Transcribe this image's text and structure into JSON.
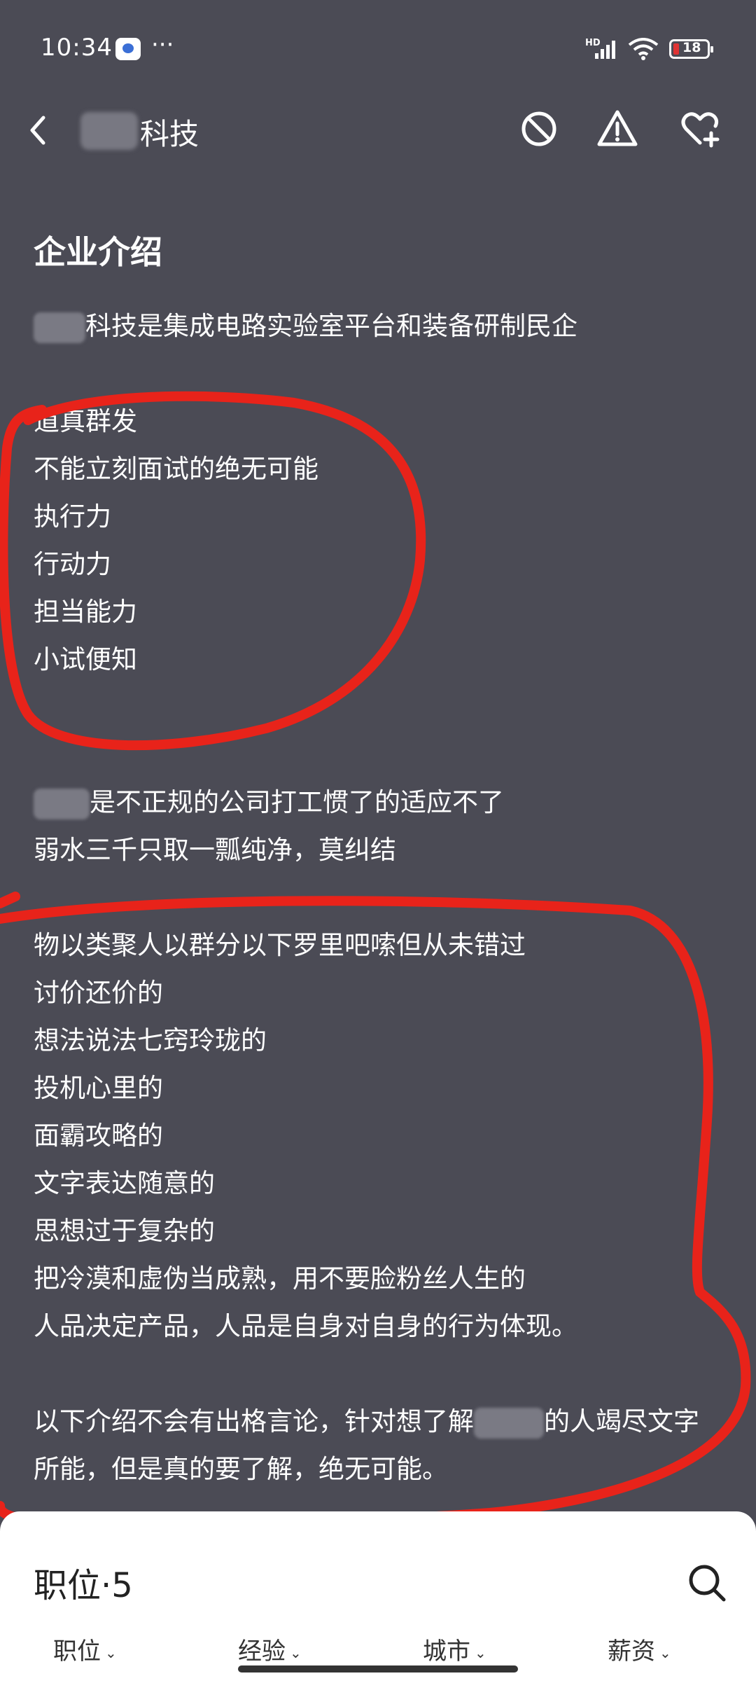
{
  "status_bar": {
    "time": "10:34",
    "more": "···",
    "network": "HD",
    "battery": "18"
  },
  "header": {
    "company_suffix": "科技"
  },
  "intro": {
    "title": "企业介绍",
    "lines": [
      "科技是集成电路实验室平台和装备研制民企",
      "道真群发",
      "不能立刻面试的绝无可能",
      "执行力",
      "行动力",
      "担当能力",
      "小试便知",
      "是不正规的公司打工惯了的适应不了",
      "弱水三千只取一瓢纯净，莫纠结",
      "物以类聚人以群分以下罗里吧嗦但从未错过",
      "讨价还价的",
      "想法说法七窍玲珑的",
      "投机心里的",
      "面霸攻略的",
      "文字表达随意的",
      "思想过于复杂的",
      "把冷漠和虚伪当成熟，用不要脸粉丝人生的",
      "人品决定产品，人品是自身对自身的行为体现。",
      "以下介绍不会有出格言论，针对想了解",
      "的人竭尽文字",
      "所能，但是真的要了解，绝无可能。"
    ]
  },
  "jobs": {
    "title": "职位·5",
    "filters": [
      "职位",
      "经验",
      "城市",
      "薪资"
    ]
  },
  "colors": {
    "background": "#4b4b55",
    "annotation_red": "#e8231a",
    "sheet": "#ffffff"
  }
}
